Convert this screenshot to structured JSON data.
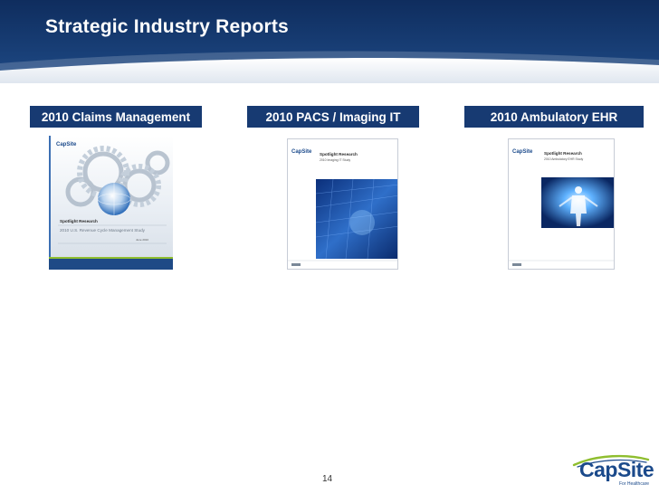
{
  "header": {
    "title": "Strategic Industry Reports"
  },
  "columns": [
    {
      "label": "2010 Claims Management",
      "cover": {
        "logo": "CapSite",
        "heading": "Spotlight Research",
        "subheading": "2010 U.S. Revenue Cycle Management Study",
        "date": "June 2010"
      }
    },
    {
      "label": "2010 PACS / Imaging IT",
      "cover": {
        "logo": "CapSite",
        "heading": "Spotlight Research",
        "subheading": "2010 Imaging IT Study"
      }
    },
    {
      "label": "2010 Ambulatory EHR",
      "cover": {
        "logo": "CapSite",
        "heading": "Spotlight Research",
        "subheading": "2010 Ambulatory EHR Study"
      }
    }
  ],
  "footer": {
    "page_number": "14",
    "logo_main": "CapSite",
    "logo_tagline": "For Healthcare"
  },
  "colors": {
    "brand_navy": "#173a72",
    "brand_green": "#8fbe2f"
  }
}
